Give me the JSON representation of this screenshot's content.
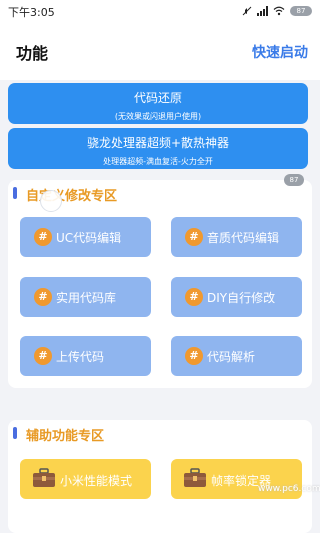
{
  "status_bar": {
    "time": "下午3:05",
    "battery": "87"
  },
  "header": {
    "title": "功能",
    "action_label": "快速启动"
  },
  "banners": [
    {
      "title": "代码还原",
      "subtitle": "(无效果或闪退用户使用)"
    },
    {
      "title": "骁龙处理器超频+散热神器",
      "subtitle": "处理器超频-满血复活-火力全开"
    }
  ],
  "custom_section": {
    "title": "自定义修改专区",
    "badge": "87",
    "tiles": [
      {
        "label": "UC代码编辑",
        "icon": "hash-icon"
      },
      {
        "label": "音质代码编辑",
        "icon": "hash-icon"
      },
      {
        "label": "实用代码库",
        "icon": "hash-icon"
      },
      {
        "label": "DIY自行修改",
        "icon": "hash-icon"
      },
      {
        "label": "上传代码",
        "icon": "hash-icon"
      },
      {
        "label": "代码解析",
        "icon": "hash-icon"
      }
    ]
  },
  "aux_section": {
    "title": "辅助功能专区",
    "tiles": [
      {
        "label": "小米性能模式",
        "icon": "toolbox-icon"
      },
      {
        "label": "帧率锁定器",
        "icon": "toolbox-icon"
      }
    ]
  },
  "watermark": "www.pc6.com",
  "colors": {
    "accent_blue": "#2e8ff0",
    "tile_blue": "#8fb5ef",
    "tile_icon_orange": "#f0992f",
    "section_title_orange": "#e89a25",
    "aux_tile_yellow": "#fbd34d",
    "header_action_blue": "#3a7be8"
  }
}
